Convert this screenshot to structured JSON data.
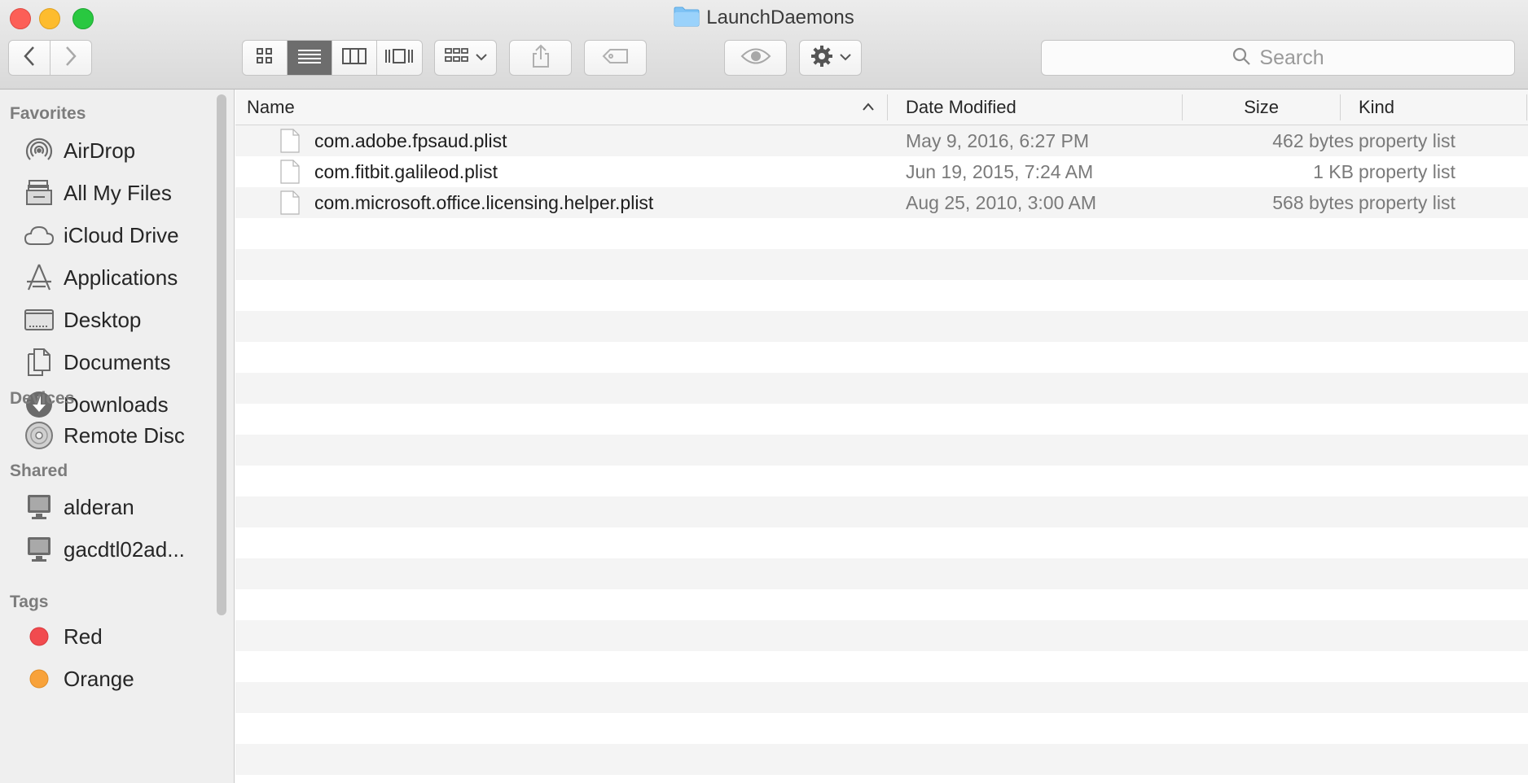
{
  "window": {
    "title": "LaunchDaemons",
    "title_icon": "folder-icon"
  },
  "traffic_lights": {
    "close": "#fc5f57",
    "minimize": "#fdbc2e",
    "zoom": "#29c840"
  },
  "toolbar": {
    "back_icon": "chevron-left-icon",
    "forward_icon": "chevron-right-icon",
    "view_modes": [
      "icon-view",
      "list-view",
      "column-view",
      "cover-flow-view"
    ],
    "active_view": "list-view",
    "arrange_icon": "arrange-grid-icon",
    "share_icon": "share-icon",
    "tag_icon": "tag-icon",
    "quicklook_icon": "eye-icon",
    "action_icon": "gear-icon",
    "search_placeholder": "Search"
  },
  "sidebar": {
    "favorites_header": "Favorites",
    "favorites": [
      {
        "label": "AirDrop",
        "icon": "airdrop-icon"
      },
      {
        "label": "All My Files",
        "icon": "all-files-icon"
      },
      {
        "label": "iCloud Drive",
        "icon": "cloud-icon"
      },
      {
        "label": "Applications",
        "icon": "applications-icon"
      },
      {
        "label": "Desktop",
        "icon": "desktop-icon"
      },
      {
        "label": "Documents",
        "icon": "documents-icon"
      },
      {
        "label": "Downloads",
        "icon": "download-icon"
      }
    ],
    "devices_header": "Devices",
    "devices": [
      {
        "label": "Remote Disc",
        "icon": "disc-icon"
      }
    ],
    "shared_header": "Shared",
    "shared": [
      {
        "label": "alderan",
        "icon": "computer-icon"
      },
      {
        "label": "gacdtl02ad...",
        "icon": "computer-icon"
      }
    ],
    "tags_header": "Tags",
    "tags": [
      {
        "label": "Red",
        "color": "#f14b4f"
      },
      {
        "label": "Orange",
        "color": "#f8a23a"
      }
    ]
  },
  "columns": {
    "name": "Name",
    "date_modified": "Date Modified",
    "size": "Size",
    "kind": "Kind",
    "sort_icon": "chevron-up-icon"
  },
  "files": [
    {
      "name": "com.adobe.fpsaud.plist",
      "date": "May 9, 2016, 6:27 PM",
      "size": "462 bytes",
      "kind": "property list"
    },
    {
      "name": "com.fitbit.galileod.plist",
      "date": "Jun 19, 2015, 7:24 AM",
      "size": "1 KB",
      "kind": "property list"
    },
    {
      "name": "com.microsoft.office.licensing.helper.plist",
      "date": "Aug 25, 2010, 3:00 AM",
      "size": "568 bytes",
      "kind": "property list"
    }
  ]
}
